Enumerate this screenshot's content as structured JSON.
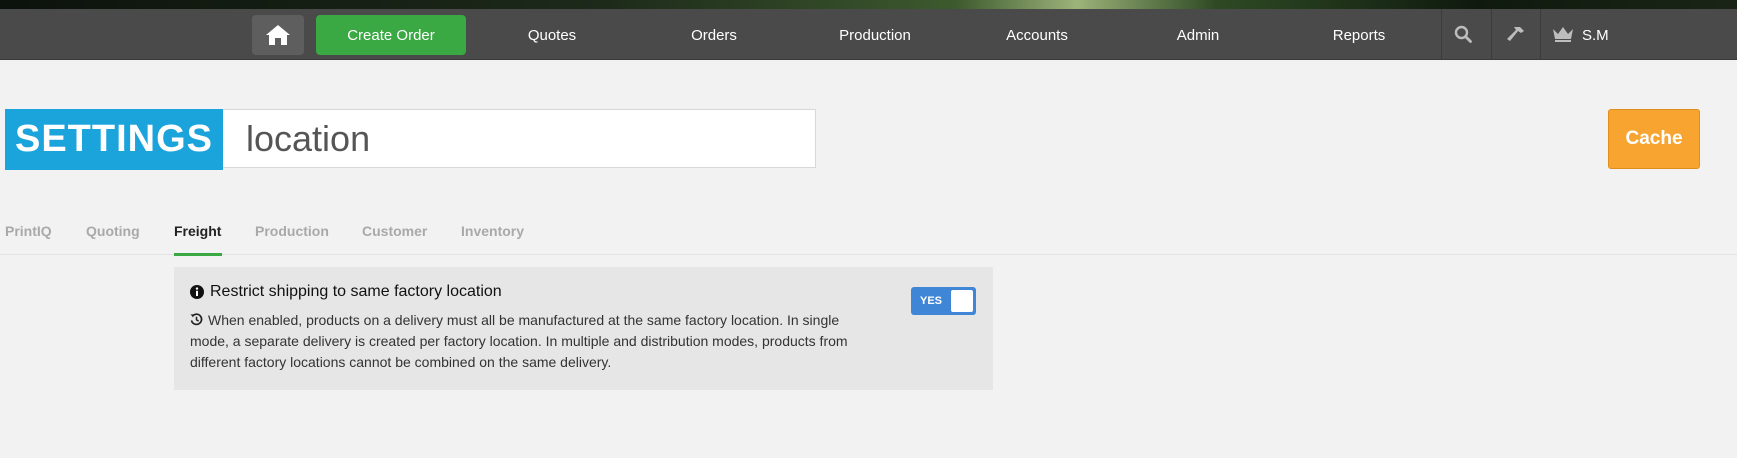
{
  "nav": {
    "create_order": "Create Order",
    "items": [
      "Quotes",
      "Orders",
      "Production",
      "Accounts",
      "Admin",
      "Reports"
    ],
    "user": "S.M",
    "icons": [
      "home-icon",
      "search-icon",
      "hammer-icon",
      "crown-icon"
    ]
  },
  "header": {
    "badge": "SETTINGS",
    "search_value": "location",
    "cache_label": "Cache"
  },
  "tabs": [
    "PrintIQ",
    "Quoting",
    "Freight",
    "Production",
    "Customer",
    "Inventory"
  ],
  "active_tab": "Freight",
  "setting": {
    "title": "Restrict shipping to same factory location",
    "description": "When enabled, products on a delivery must all be manufactured at the same factory location. In single mode, a separate delivery is created per factory location. In multiple and distribution modes, products from different factory locations cannot be combined on the same delivery.",
    "toggle_label": "YES",
    "toggle_on": true
  },
  "colors": {
    "nav_bg": "#4a4a4a",
    "create_order": "#3aa843",
    "settings_badge": "#1ba3dc",
    "cache_button": "#f7a530",
    "toggle_on": "#3f87d6"
  }
}
